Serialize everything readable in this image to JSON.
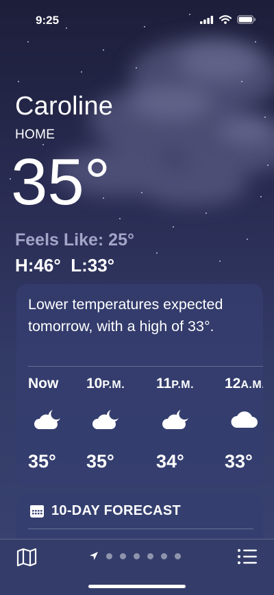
{
  "status_bar": {
    "time": "9:25"
  },
  "location": {
    "city": "Caroline",
    "subtitle": "HOME"
  },
  "current": {
    "temperature": "35°",
    "feels_like": "Feels Like: 25°",
    "high_low": "H:46°  L:33°"
  },
  "hourly_card": {
    "summary": "Lower temperatures expected tomorrow, with a high of 33°.",
    "hours": [
      {
        "time": "Now",
        "suffix": "",
        "icon": "cloud-moon-icon",
        "temp": "35°"
      },
      {
        "time": "10",
        "suffix": "P.M.",
        "icon": "cloud-moon-icon",
        "temp": "35°"
      },
      {
        "time": "11",
        "suffix": "P.M.",
        "icon": "cloud-moon-icon",
        "temp": "34°"
      },
      {
        "time": "12",
        "suffix": "A.M.",
        "icon": "cloud-icon",
        "temp": "33°"
      }
    ]
  },
  "ten_day_card": {
    "icon": "calendar-icon",
    "title": "10-DAY FORECAST"
  },
  "bottom_bar": {
    "map_icon": "map-icon",
    "location_icon": "location-arrow-icon",
    "page_dots": 6,
    "list_icon": "list-icon"
  },
  "colors": {
    "background_top": "#1d1e3a",
    "background_bottom": "#3a4470",
    "card": "#343f70",
    "feels_like_text": "#a4a6c8",
    "bottom_bar": "#343d6a"
  }
}
